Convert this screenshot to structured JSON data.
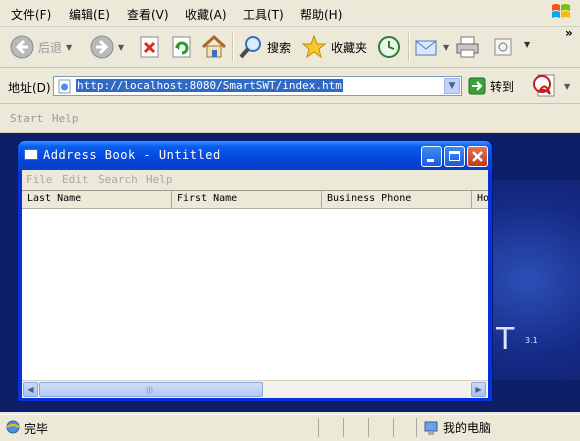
{
  "menubar": {
    "items": [
      {
        "label": "文件(F)"
      },
      {
        "label": "编辑(E)"
      },
      {
        "label": "查看(V)"
      },
      {
        "label": "收藏(A)"
      },
      {
        "label": "工具(T)"
      },
      {
        "label": "帮助(H)"
      }
    ]
  },
  "toolbar": {
    "back_label": "后退",
    "search_label": "搜索",
    "favorites_label": "收藏夹",
    "overflow": "»"
  },
  "address": {
    "label": "地址(D)",
    "url": "http://localhost:8080/SmartSWT/index.htm",
    "go_label": "转到"
  },
  "page": {
    "menu": [
      "Start",
      "Help"
    ],
    "version_big": "T",
    "version_small": "3.1"
  },
  "app_window": {
    "title": "Address Book - Untitled",
    "menu": [
      "File",
      "Edit",
      "Search",
      "Help"
    ],
    "columns": [
      "Last Name",
      "First Name",
      "Business Phone",
      "Ho"
    ],
    "rows": []
  },
  "statusbar": {
    "status_text": "完毕",
    "zone_text": "我的电脑"
  },
  "colors": {
    "xp_titlebar": "#0a5ff0",
    "page_background": "#0f1f67",
    "selection": "#316ac5",
    "chrome": "#ece9d8"
  }
}
